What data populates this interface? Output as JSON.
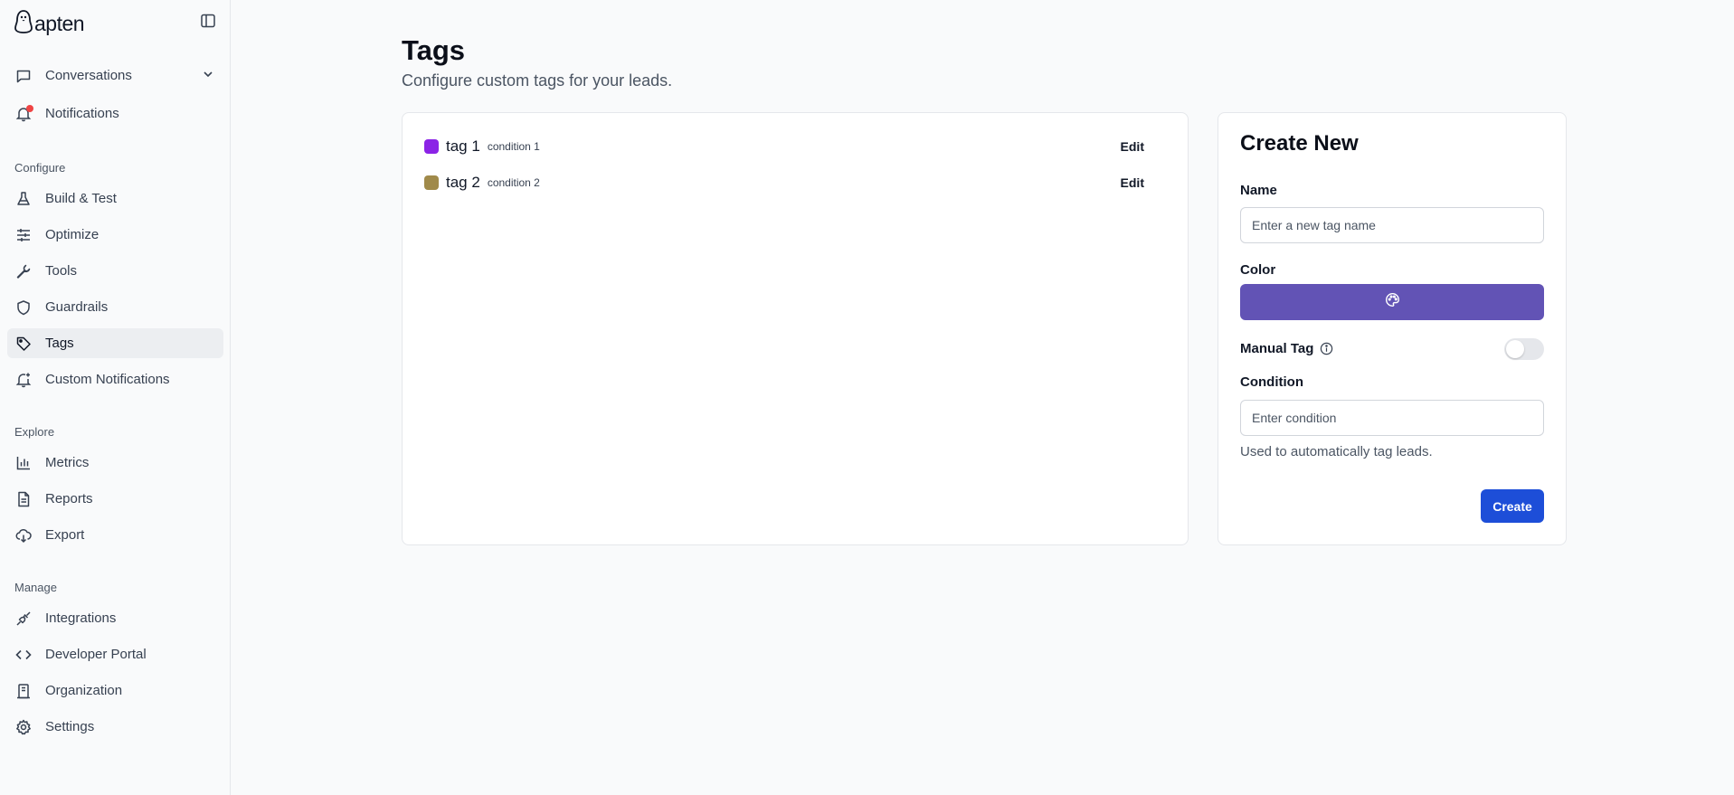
{
  "brand": {
    "name": "apten"
  },
  "colors": {
    "accent": "#1d4ed8",
    "color_picker": "#6253b5",
    "tag1": "#8b23e6",
    "tag2": "#a08a4a",
    "notification_dot": "#ef4444"
  },
  "sidebar": {
    "top_items": [
      {
        "label": "Conversations",
        "icon": "chat-icon"
      },
      {
        "label": "Notifications",
        "icon": "bell-icon"
      }
    ],
    "sections": [
      {
        "label": "Configure",
        "items": [
          {
            "label": "Build & Test",
            "icon": "flask-icon"
          },
          {
            "label": "Optimize",
            "icon": "sliders-icon"
          },
          {
            "label": "Tools",
            "icon": "wrench-icon"
          },
          {
            "label": "Guardrails",
            "icon": "shield-icon"
          },
          {
            "label": "Tags",
            "icon": "tag-icon",
            "active": true
          },
          {
            "label": "Custom Notifications",
            "icon": "bell-plus-icon"
          }
        ]
      },
      {
        "label": "Explore",
        "items": [
          {
            "label": "Metrics",
            "icon": "bar-chart-icon"
          },
          {
            "label": "Reports",
            "icon": "file-icon"
          },
          {
            "label": "Export",
            "icon": "cloud-download-icon"
          }
        ]
      },
      {
        "label": "Manage",
        "items": [
          {
            "label": "Integrations",
            "icon": "plug-icon"
          },
          {
            "label": "Developer Portal",
            "icon": "code-icon"
          },
          {
            "label": "Organization",
            "icon": "building-icon"
          },
          {
            "label": "Settings",
            "icon": "gear-icon"
          }
        ]
      }
    ]
  },
  "page": {
    "title": "Tags",
    "subtitle": "Configure custom tags for your leads."
  },
  "tags": [
    {
      "name": "tag 1",
      "condition": "condition 1",
      "edit_label": "Edit"
    },
    {
      "name": "tag 2",
      "condition": "condition 2",
      "edit_label": "Edit"
    }
  ],
  "create_form": {
    "title": "Create New",
    "name_label": "Name",
    "name_placeholder": "Enter a new tag name",
    "name_value": "",
    "color_label": "Color",
    "manual_tag_label": "Manual Tag",
    "manual_tag_enabled": false,
    "condition_label": "Condition",
    "condition_placeholder": "Enter condition",
    "condition_value": "",
    "helper_text": "Used to automatically tag leads.",
    "submit_label": "Create"
  }
}
